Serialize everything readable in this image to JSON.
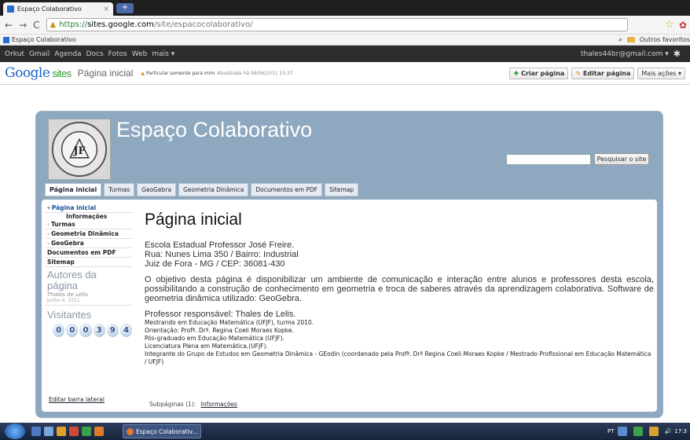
{
  "browser": {
    "tab_title": "Espaço Colaborativo",
    "tab_close": "×",
    "new_tab": "+",
    "url_prefix": "https://",
    "url_host": "sites.google.com",
    "url_path": "/site/espacocolaborativo/",
    "bookmark": "Espaço Colaborativo",
    "bookmarks_chevron": "»",
    "other_bookmarks": "Outros favoritos"
  },
  "google_bar": {
    "links": [
      "Orkut",
      "Gmail",
      "Agenda",
      "Docs",
      "Fotos",
      "Web",
      "mais ▾"
    ],
    "user": "thales44br@gmail.com ▾"
  },
  "sites_header": {
    "logo_google": "Google",
    "logo_sites": "sites",
    "page_name": "Página inicial",
    "privacy": "Particular somente para mim",
    "updated": "Atualizada há 06/06/2011 15:37",
    "create_page": "Criar página",
    "edit_page": "Editar página",
    "more_actions": "Mais ações ▾"
  },
  "site": {
    "title": "Espaço Colaborativo",
    "search_button": "Pesquisar o site",
    "search_placeholder": "",
    "logo_alt_text": "ESCOLA ESTADUAL PROFESSOR JOSÉ FREIRE",
    "logo_initials": "JF",
    "nav": [
      "Página inicial",
      "Turmas",
      "GeoGebra",
      "Geometria Dinâmica",
      "Documentos em PDF",
      "Sitemap"
    ]
  },
  "sidebar": {
    "items": [
      {
        "label": "Página inicial",
        "chevron": "▾"
      },
      {
        "label": "Informações"
      },
      {
        "label": "Turmas",
        "chevron": "›"
      },
      {
        "label": "Geometria Dinâmica",
        "chevron": "›"
      },
      {
        "label": "GeoGebra",
        "chevron": "›"
      },
      {
        "label": "Documentos em PDF"
      },
      {
        "label": "Sitemap"
      }
    ],
    "authors_heading": "Autores da página",
    "author_name": "Thales de Lelis",
    "author_date": "Junho 6, 2011",
    "visitors_heading": "Visitantes",
    "counter_digits": [
      "0",
      "0",
      "0",
      "3",
      "9",
      "4"
    ],
    "edit_sidebar": "Editar barra lateral"
  },
  "main": {
    "heading": "Página inicial",
    "address": [
      "Escola Estadual Professor José Freire.",
      "Rua: Nunes Lima 350 / Bairro: Industrial",
      "Juiz de Fora - MG / CEP: 36081-430"
    ],
    "objective": "O objetivo desta página é disponibilizar um ambiente de comunicação e interação entre alunos e professores desta escola, possibilitando a construção de conhecimento em geometria e troca de saberes através da aprendizagem colaborativa. Software de geometria dinâmica utilizado: GeoGebra.",
    "responsible": "Professor responsável: Thales de Lelis.",
    "credentials": [
      "Mestrando em Educação Matemática (UFJF), turma 2010.",
      "Orientação: Profª. Drª. Regina Coeli Moraes Kopke.",
      "Pós-graduado em Educação Matemática (UFJF).",
      "Licenciatura Plena em Matemática,(UFJF).",
      "Integrante do Grupo de Estudos em Geometria Dinâmica - GEodin (coordenado pela Profª. Drª Regina Coeli Moraes Kopke / Mestrado Profissional em Educação Matemática / UFJF)"
    ],
    "subpages_label": "Subpáginas (1):",
    "subpages_link": "Informações"
  },
  "taskbar": {
    "task_label": "Espaço Colaborativ...",
    "lang": "PT",
    "clock": "17:3"
  }
}
